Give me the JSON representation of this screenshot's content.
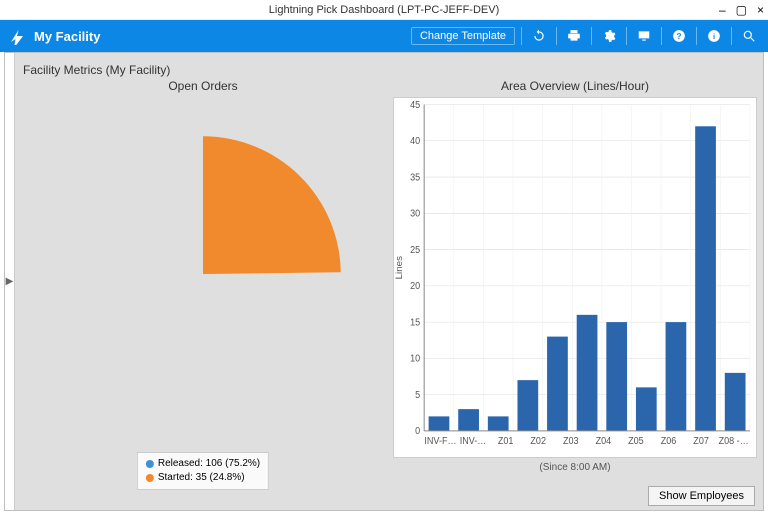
{
  "window": {
    "title": "Lightning Pick Dashboard (LPT-PC-JEFF-DEV)"
  },
  "header": {
    "facility": "My Facility",
    "change_template": "Change Template"
  },
  "panel": {
    "title": "Facility Metrics (My Facility)"
  },
  "buttons": {
    "show_employees": "Show Employees"
  },
  "colors": {
    "brand": "#0c87e6",
    "pie_released": "#3f90d2",
    "pie_started": "#f08a2c",
    "bar": "#2b66ad"
  },
  "chart_data": [
    {
      "type": "pie",
      "title": "Open Orders",
      "series": [
        {
          "name": "Released",
          "value": 106,
          "percent": 75.2,
          "color": "#3f90d2"
        },
        {
          "name": "Started",
          "value": 35,
          "percent": 24.8,
          "color": "#f08a2c"
        }
      ],
      "legend_labels": [
        "Released: 106 (75.2%)",
        "Started: 35 (24.8%)"
      ]
    },
    {
      "type": "bar",
      "title": "Area Overview (Lines/Hour)",
      "ylabel": "Lines",
      "subtitle": "(Since 8:00 AM)",
      "ylim": [
        0,
        45
      ],
      "yticks": [
        0,
        5,
        10,
        15,
        20,
        25,
        30,
        35,
        40,
        45
      ],
      "categories": [
        "INV-F…",
        "INV-…",
        "Z01",
        "Z02",
        "Z03",
        "Z04",
        "Z05",
        "Z06",
        "Z07",
        "Z08 -…"
      ],
      "values": [
        2,
        3,
        2,
        7,
        13,
        16,
        15,
        6,
        15,
        42,
        8
      ],
      "note_values_count": 11
    }
  ]
}
